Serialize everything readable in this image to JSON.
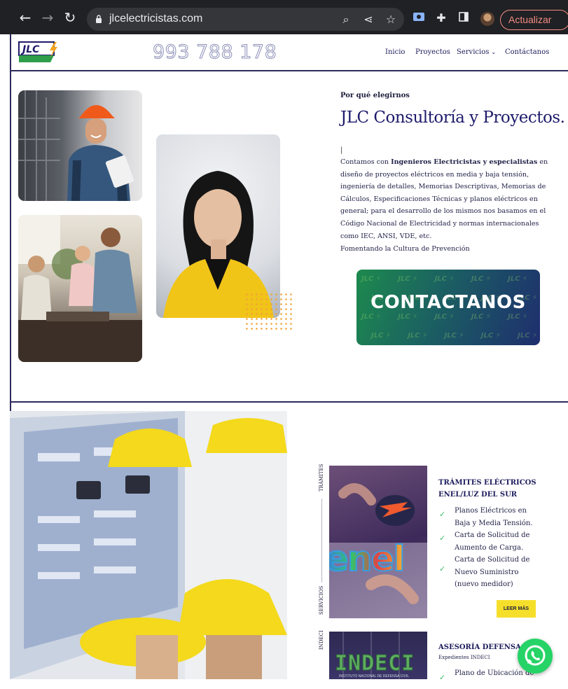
{
  "browser": {
    "url": "jlcelectricistas.com",
    "update_label": "Actualizar"
  },
  "header": {
    "logo_text": "JLC",
    "phone": "993 788 178",
    "menu": [
      "Inicio",
      "Proyectos",
      "Servicios",
      "Contáctanos"
    ]
  },
  "intro": {
    "eyebrow": "Por qué elegirnos",
    "heading": "JLC Consultoría y Proyectos.",
    "cursor": "|",
    "body_prefix": "Contamos con ",
    "body_bold": "Ingenieros Electricistas y especialistas",
    "body_rest": " en diseño de proyectos eléctricos en media y baja tensión, ingeniería de detalles, Memorias Descriptivas, Memorias de Cálculos, Especificaciones Técnicas y planos eléctricos en general; para el desarrollo de los mismos nos basamos en el Código Nacional de Electricidad y normas internacionales como IEC, ANSI, VDE, etc.",
    "tagline": "Fomentando la Cultura de Prevención",
    "banner_label": "CONTACTANOS",
    "banner_pattern_text": "JLC"
  },
  "services": {
    "side_label_top": "TRÁMITES",
    "side_label_bottom": "SERVICIOS",
    "side_label_next": "INDECI",
    "card1": {
      "brand": "enel",
      "title_line1": "TRÁMITES ELÉCTRICOS",
      "title_line2": "ENEL/LUZ DEL SUR",
      "items": [
        [
          "Planos Eléctricos en",
          "Baja y Media Tensión."
        ],
        [
          "Carta de Solicitud de",
          "Aumento de Carga."
        ],
        [
          "Carta de Solicitud de",
          "Nuevo Suministro",
          "(nuevo medidor)"
        ]
      ],
      "button": "LEER MÁS"
    },
    "card2": {
      "brand": "INDECI",
      "brand_sub": "INSTITUTO NACIONAL DE DEFENSA CIVIL",
      "title": "ASESORÍA DEFENSA CIVIL",
      "caption": "Expedientes INDECI",
      "first_item": "Plano de Ubicación de"
    }
  },
  "colors": {
    "brand_navy": "#2d2a5e",
    "accent_yellow": "#f6df2b",
    "check_green": "#3fbf6a",
    "whatsapp_green": "#25d366"
  }
}
